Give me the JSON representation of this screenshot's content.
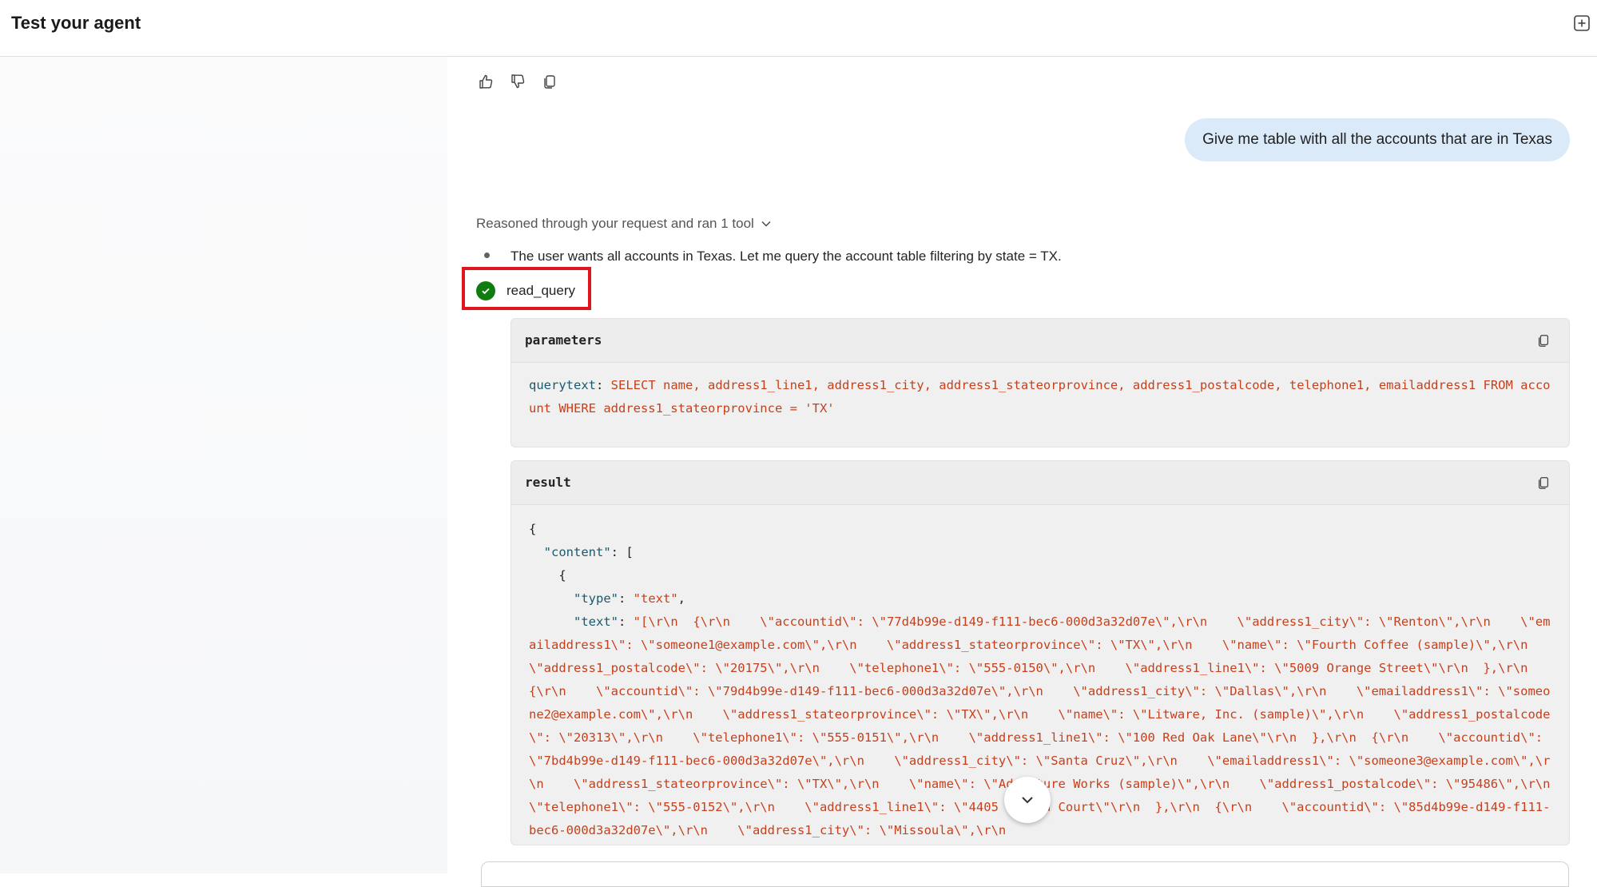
{
  "header": {
    "title": "Test your agent",
    "new_chat_icon": "add-square-icon"
  },
  "feedback": {
    "icons": [
      "thumbs-up-icon",
      "thumbs-down-icon",
      "copy-icon"
    ]
  },
  "user_message": "Give me table with all the accounts that are in Texas",
  "reasoning": {
    "summary": "Reasoned through your request and ran 1 tool",
    "step": "The user wants all accounts in Texas. Let me query the account table filtering by state = TX."
  },
  "tool": {
    "name": "read_query",
    "status": "success",
    "highlight_color": "#e0151d",
    "parameters": {
      "label": "parameters",
      "key": "querytext",
      "value": "SELECT name, address1_line1, address1_city, address1_stateorprovince, address1_postalcode, telephone1, emailaddress1 FROM account WHERE address1_stateorprovince = 'TX'"
    },
    "result": {
      "label": "result",
      "line_open": "{",
      "content_key": "\"content\"",
      "content_open": ": [",
      "obj_open": "{",
      "type_key": "\"type\"",
      "type_value": "\"text\"",
      "text_key": "\"text\"",
      "text_value": "\"[\\r\\n  {\\r\\n    \\\"accountid\\\": \\\"77d4b99e-d149-f111-bec6-000d3a32d07e\\\",\\r\\n    \\\"address1_city\\\": \\\"Renton\\\",\\r\\n    \\\"emailaddress1\\\": \\\"someone1@example.com\\\",\\r\\n    \\\"address1_stateorprovince\\\": \\\"TX\\\",\\r\\n    \\\"name\\\": \\\"Fourth Coffee (sample)\\\",\\r\\n    \\\"address1_postalcode\\\": \\\"20175\\\",\\r\\n    \\\"telephone1\\\": \\\"555-0150\\\",\\r\\n    \\\"address1_line1\\\": \\\"5009 Orange Street\\\"\\r\\n  },\\r\\n  {\\r\\n    \\\"accountid\\\": \\\"79d4b99e-d149-f111-bec6-000d3a32d07e\\\",\\r\\n    \\\"address1_city\\\": \\\"Dallas\\\",\\r\\n    \\\"emailaddress1\\\": \\\"someone2@example.com\\\",\\r\\n    \\\"address1_stateorprovince\\\": \\\"TX\\\",\\r\\n    \\\"name\\\": \\\"Litware, Inc. (sample)\\\",\\r\\n    \\\"address1_postalcode\\\": \\\"20313\\\",\\r\\n    \\\"telephone1\\\": \\\"555-0151\\\",\\r\\n    \\\"address1_line1\\\": \\\"100 Red Oak Lane\\\"\\r\\n  },\\r\\n  {\\r\\n    \\\"accountid\\\": \\\"7bd4b99e-d149-f111-bec6-000d3a32d07e\\\",\\r\\n    \\\"address1_city\\\": \\\"Santa Cruz\\\",\\r\\n    \\\"emailaddress1\\\": \\\"someone3@example.com\\\",\\r\\n    \\\"address1_stateorprovince\\\": \\\"TX\\\",\\r\\n    \\\"name\\\": \\\"Adventure Works (sample)\\\",\\r\\n    \\\"address1_postalcode\\\": \\\"95486\\\",\\r\\n    \\\"telephone1\\\": \\\"555-0152\\\",\\r\\n    \\\"address1_line1\\\": \\\"4405 Balboa Court\\\"\\r\\n  },\\r\\n  {\\r\\n    \\\"accountid\\\": \\\"85d4b99e-d149-f111-bec6-000d3a32d07e\\\",\\r\\n    \\\"address1_city\\\": \\\"Missoula\\\",\\r\\n"
    }
  },
  "scroll_down_icon": "chevron-down-icon"
}
